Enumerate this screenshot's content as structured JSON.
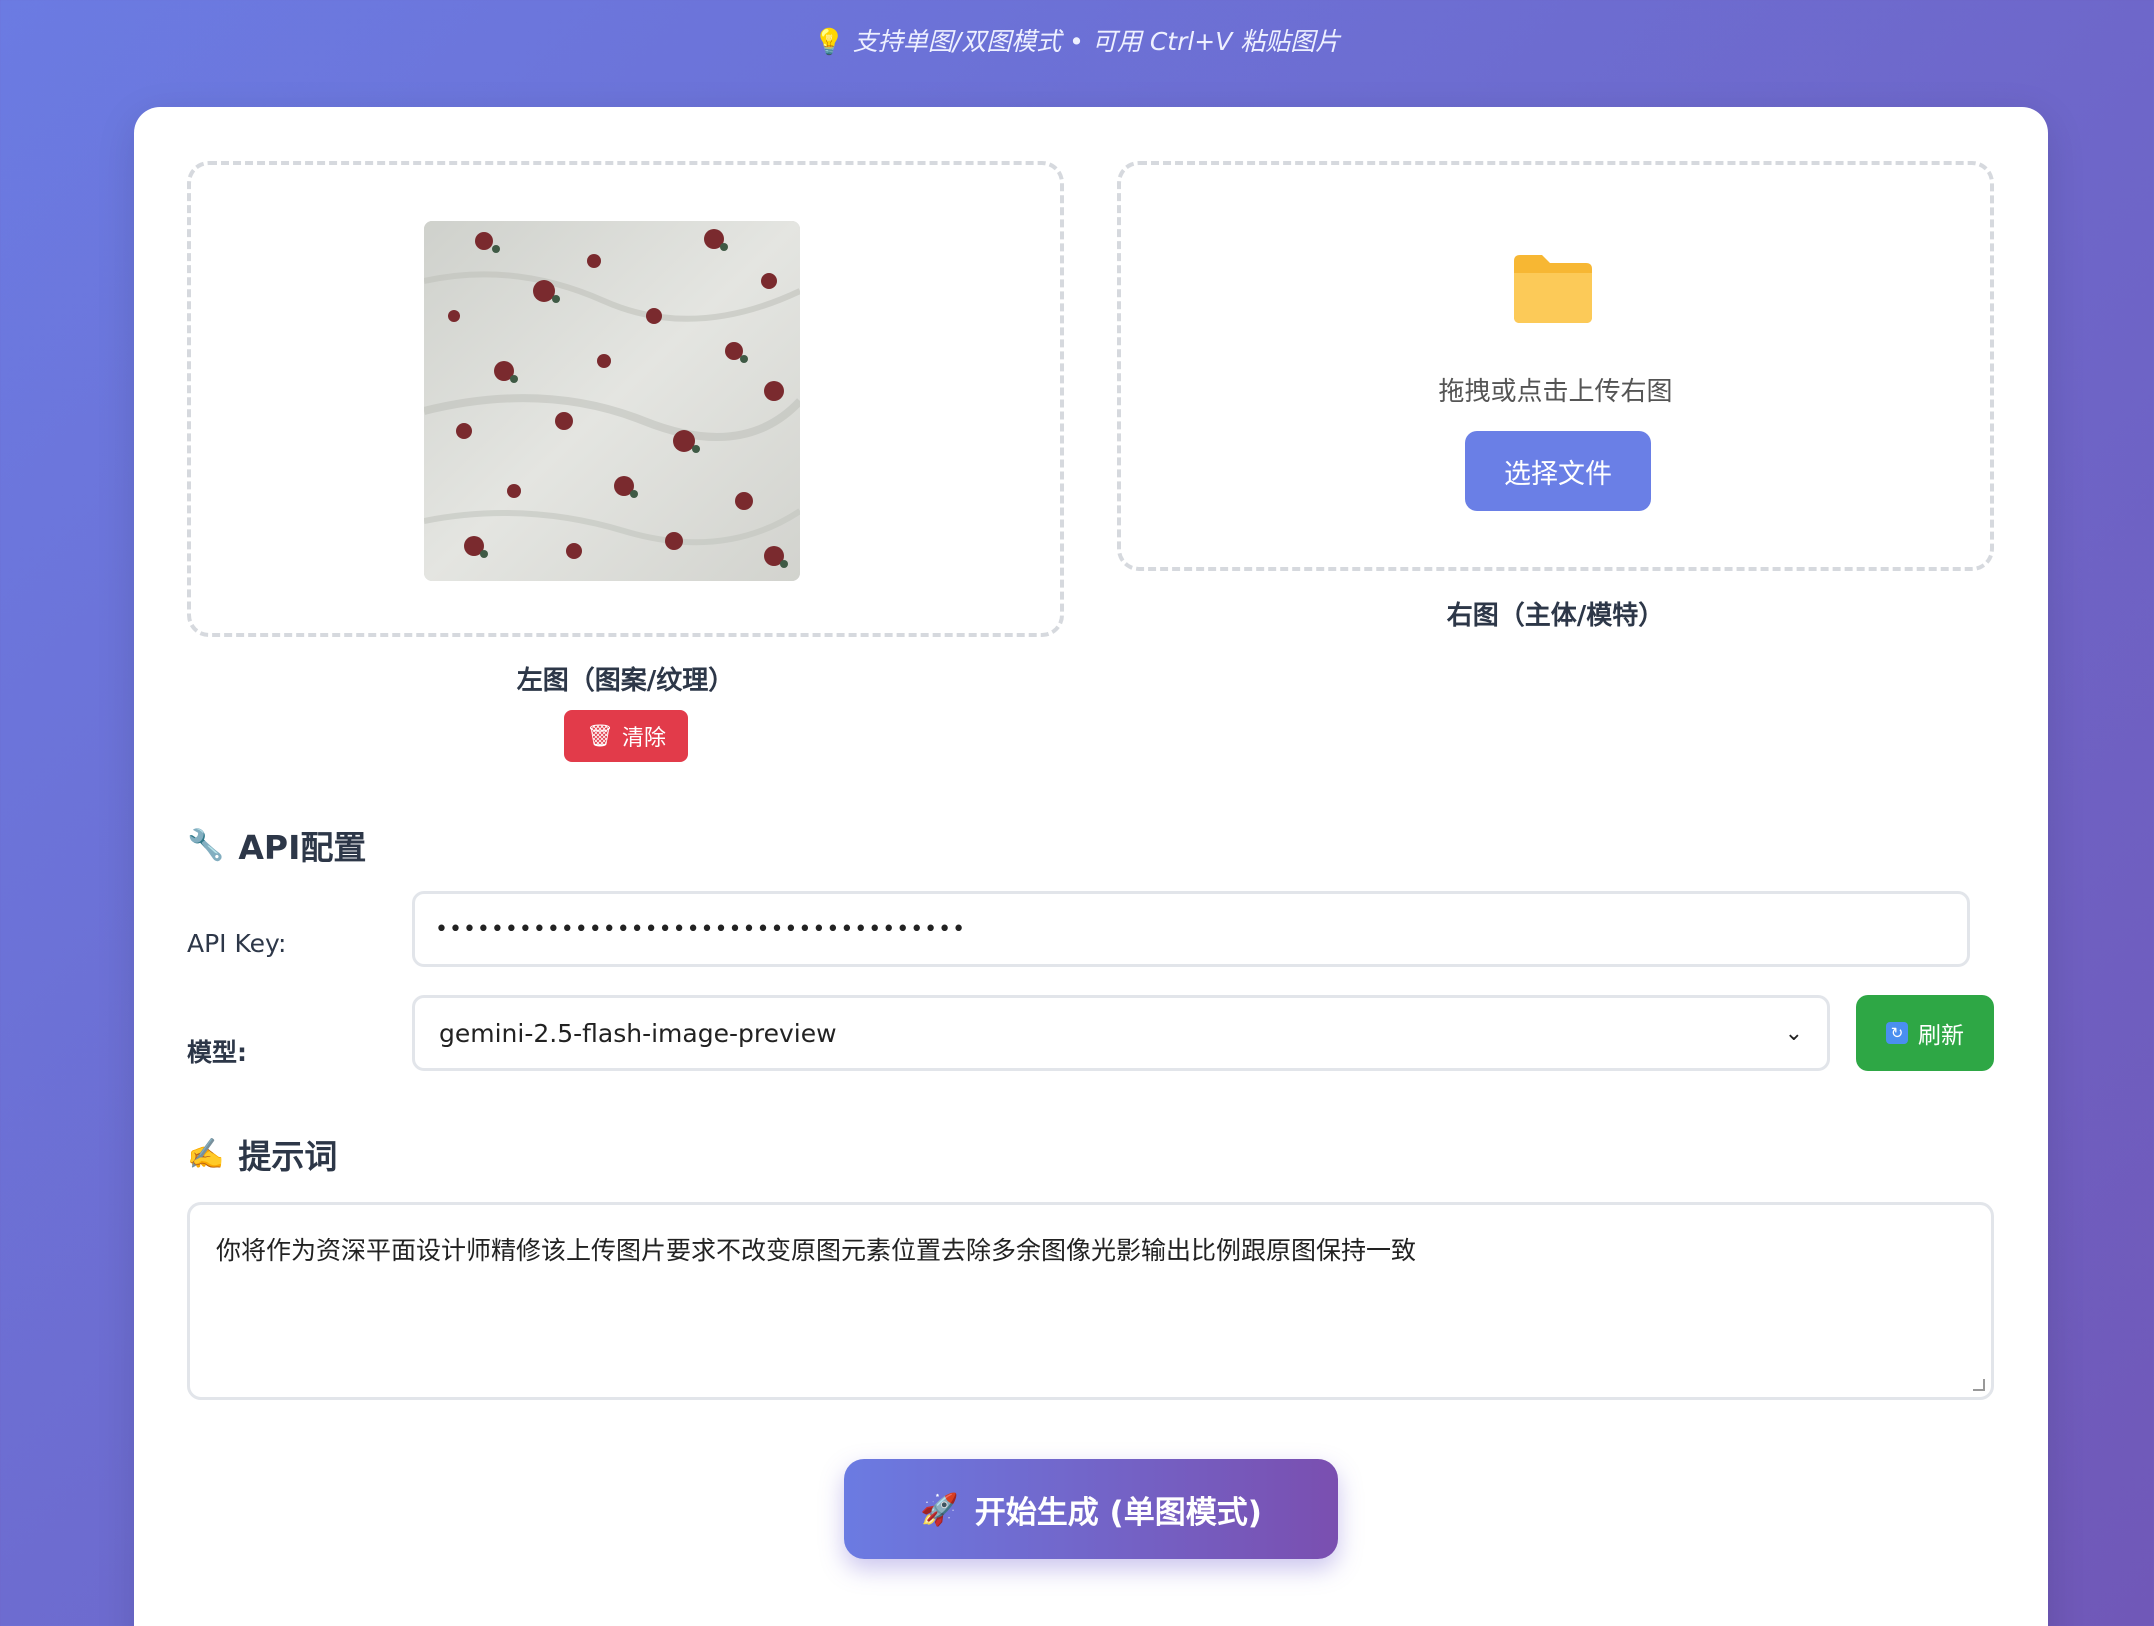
{
  "header": {
    "subtitle": "支持单图/双图模式 • 可用 Ctrl+V 粘贴图片",
    "subtitle_icon": "lightbulb-icon"
  },
  "uploads": {
    "left": {
      "label": "左图（图案/纹理）",
      "has_image": true,
      "clear_label": "清除",
      "clear_icon": "trash-icon"
    },
    "right": {
      "label": "右图（主体/模特）",
      "hint": "拖拽或点击上传右图",
      "button_label": "选择文件",
      "icon": "folder-icon"
    }
  },
  "api": {
    "title": "API配置",
    "title_icon": "wrench-icon",
    "key_label": "API Key:",
    "key_value": "••••••••••••••••••••••••••••••••••••••",
    "model_label": "模型:",
    "model_value": "gemini-2.5-flash-image-preview",
    "refresh_label": "刷新",
    "refresh_icon": "refresh-icon"
  },
  "prompt": {
    "title": "提示词",
    "title_icon": "writing-hand-icon",
    "value": "你将作为资深平面设计师精修该上传图片要求不改变原图元素位置去除多余图像光影输出比例跟原图保持一致"
  },
  "actions": {
    "generate_label": "开始生成 (单图模式)",
    "generate_icon": "rocket-icon"
  },
  "colors": {
    "primary": "#6a7fe6",
    "danger": "#e23b4a",
    "success": "#2ea745"
  }
}
